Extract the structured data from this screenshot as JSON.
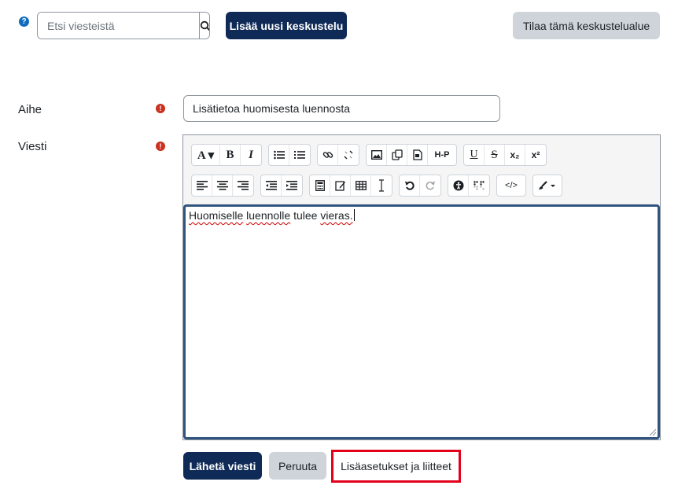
{
  "top": {
    "help_icon": "?",
    "search": {
      "placeholder": "Etsi viesteistä",
      "icon": "search-icon"
    },
    "add_discussion_label": "Lisää uusi keskustelu",
    "subscribe_label": "Tilaa tämä keskustelualue"
  },
  "form": {
    "subject": {
      "label": "Aihe",
      "value": "Lisätietoa huomisesta luennosta",
      "required_icon": "!"
    },
    "message": {
      "label": "Viesti",
      "required_icon": "!",
      "words": [
        "Huomiselle",
        "luennolle",
        "tulee",
        "vieras."
      ]
    }
  },
  "toolbar": {
    "row1": [
      [
        "A ▾",
        "B",
        "I"
      ],
      [
        "bullet-list-icon",
        "numbered-list-icon"
      ],
      [
        "link-icon",
        "unlink-icon"
      ],
      [
        "image-icon",
        "media-icon",
        "file-icon",
        "H-P"
      ],
      [
        "U",
        "S",
        "x₂",
        "x²"
      ]
    ],
    "row2": [
      [
        "align-left-icon",
        "align-center-icon",
        "align-right-icon"
      ],
      [
        "outdent-icon",
        "indent-icon"
      ],
      [
        "equation-icon",
        "edit-icon",
        "table-icon",
        "clear-format-icon"
      ],
      [
        "undo-icon",
        "redo-icon"
      ],
      [
        "accessibility-icon",
        "screenreader-icon"
      ],
      [
        "</>"
      ],
      [
        "brush-icon ▾"
      ]
    ]
  },
  "actions": {
    "submit_label": "Lähetä viesti",
    "cancel_label": "Peruuta",
    "advanced_label": "Lisäasetukset ja liitteet"
  },
  "colors": {
    "primary": "#0f2a56",
    "secondary": "#ced4da",
    "danger": "#ca3120",
    "highlight": "#e3001b"
  }
}
